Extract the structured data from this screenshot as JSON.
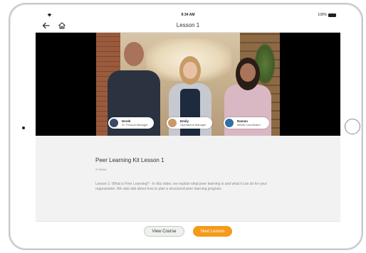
{
  "status_bar": {
    "time": "9:34 AM",
    "battery": "100%"
  },
  "nav": {
    "title": "Lesson 1"
  },
  "presenters": [
    {
      "name": "Derek",
      "role": "Sr. Product Manager"
    },
    {
      "name": "Emily",
      "role": "Operations Manager"
    },
    {
      "name": "Raman",
      "role": "Media Coordinator"
    }
  ],
  "lesson": {
    "title": "Peer Learning Kit Lesson 1",
    "views": "3 Views",
    "description": "Lesson 1: What is Peer Learning? - In this video, we explain what peer learning is and what it can do for your organization. We also talk about how to plan a structured peer learning program."
  },
  "footer": {
    "view_course_label": "View Course",
    "next_lesson_label": "Next Lesson"
  },
  "colors": {
    "accent": "#f59a1b",
    "secondary_button_bg": "#eef1ee"
  },
  "icons": {
    "back": "arrow-left",
    "home": "house",
    "wifi": "wifi",
    "battery": "battery-full"
  }
}
